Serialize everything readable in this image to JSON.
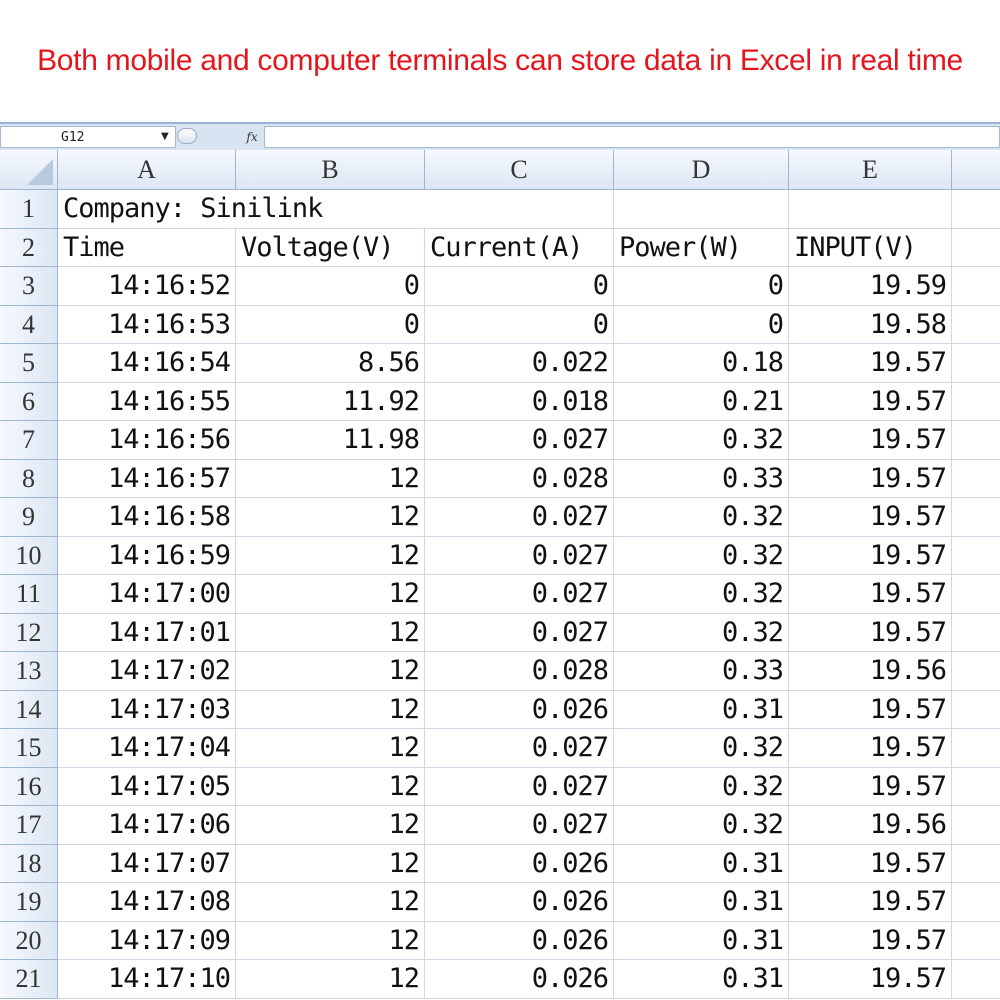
{
  "banner": {
    "text": "Both mobile and computer terminals can store data in Excel in real time"
  },
  "formula_bar": {
    "name_box": "G12",
    "fx_label": "fx",
    "formula": ""
  },
  "icons": {
    "dropdown": "chevron-down-icon",
    "cancel": "circle-icon",
    "function": "fx-icon"
  },
  "colors": {
    "banner_text": "#e3161d",
    "header_bg": "#dce6f4",
    "gridline": "#d0d7e5"
  },
  "columns": [
    "A",
    "B",
    "C",
    "D",
    "E",
    ""
  ],
  "rows": [
    {
      "num": "1",
      "cells": {
        "A": "Company: Sinilink"
      }
    },
    {
      "num": "2",
      "cells": {
        "A": "Time",
        "B": "Voltage(V)",
        "C": "Current(A)",
        "D": "Power(W)",
        "E": "INPUT(V)"
      }
    },
    {
      "num": "3",
      "cells": {
        "A": "14:16:52",
        "B": "0",
        "C": "0",
        "D": "0",
        "E": "19.59"
      }
    },
    {
      "num": "4",
      "cells": {
        "A": "14:16:53",
        "B": "0",
        "C": "0",
        "D": "0",
        "E": "19.58"
      }
    },
    {
      "num": "5",
      "cells": {
        "A": "14:16:54",
        "B": "8.56",
        "C": "0.022",
        "D": "0.18",
        "E": "19.57"
      }
    },
    {
      "num": "6",
      "cells": {
        "A": "14:16:55",
        "B": "11.92",
        "C": "0.018",
        "D": "0.21",
        "E": "19.57"
      }
    },
    {
      "num": "7",
      "cells": {
        "A": "14:16:56",
        "B": "11.98",
        "C": "0.027",
        "D": "0.32",
        "E": "19.57"
      }
    },
    {
      "num": "8",
      "cells": {
        "A": "14:16:57",
        "B": "12",
        "C": "0.028",
        "D": "0.33",
        "E": "19.57"
      }
    },
    {
      "num": "9",
      "cells": {
        "A": "14:16:58",
        "B": "12",
        "C": "0.027",
        "D": "0.32",
        "E": "19.57"
      }
    },
    {
      "num": "10",
      "cells": {
        "A": "14:16:59",
        "B": "12",
        "C": "0.027",
        "D": "0.32",
        "E": "19.57"
      }
    },
    {
      "num": "11",
      "cells": {
        "A": "14:17:00",
        "B": "12",
        "C": "0.027",
        "D": "0.32",
        "E": "19.57"
      }
    },
    {
      "num": "12",
      "cells": {
        "A": "14:17:01",
        "B": "12",
        "C": "0.027",
        "D": "0.32",
        "E": "19.57"
      }
    },
    {
      "num": "13",
      "cells": {
        "A": "14:17:02",
        "B": "12",
        "C": "0.028",
        "D": "0.33",
        "E": "19.56"
      }
    },
    {
      "num": "14",
      "cells": {
        "A": "14:17:03",
        "B": "12",
        "C": "0.026",
        "D": "0.31",
        "E": "19.57"
      }
    },
    {
      "num": "15",
      "cells": {
        "A": "14:17:04",
        "B": "12",
        "C": "0.027",
        "D": "0.32",
        "E": "19.57"
      }
    },
    {
      "num": "16",
      "cells": {
        "A": "14:17:05",
        "B": "12",
        "C": "0.027",
        "D": "0.32",
        "E": "19.57"
      }
    },
    {
      "num": "17",
      "cells": {
        "A": "14:17:06",
        "B": "12",
        "C": "0.027",
        "D": "0.32",
        "E": "19.56"
      }
    },
    {
      "num": "18",
      "cells": {
        "A": "14:17:07",
        "B": "12",
        "C": "0.026",
        "D": "0.31",
        "E": "19.57"
      }
    },
    {
      "num": "19",
      "cells": {
        "A": "14:17:08",
        "B": "12",
        "C": "0.026",
        "D": "0.31",
        "E": "19.57"
      }
    },
    {
      "num": "20",
      "cells": {
        "A": "14:17:09",
        "B": "12",
        "C": "0.026",
        "D": "0.31",
        "E": "19.57"
      }
    },
    {
      "num": "21",
      "cells": {
        "A": "14:17:10",
        "B": "12",
        "C": "0.026",
        "D": "0.31",
        "E": "19.57"
      }
    }
  ]
}
